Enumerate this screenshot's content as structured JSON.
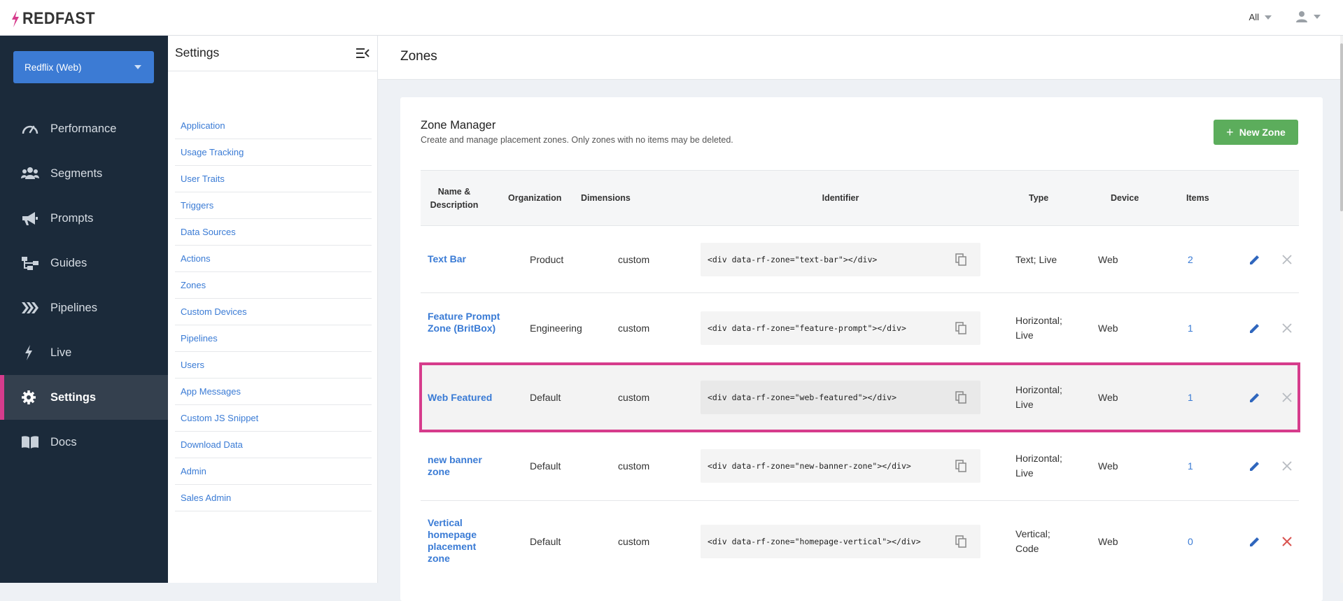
{
  "brand": {
    "name": "REDFAST"
  },
  "topbar": {
    "filter_label": "All"
  },
  "leftnav": {
    "app_selector": "Redflix (Web)",
    "items": [
      {
        "label": "Performance",
        "icon": "gauge-icon"
      },
      {
        "label": "Segments",
        "icon": "users-icon"
      },
      {
        "label": "Prompts",
        "icon": "megaphone-icon"
      },
      {
        "label": "Guides",
        "icon": "sitemap-icon"
      },
      {
        "label": "Pipelines",
        "icon": "pipelines-icon"
      },
      {
        "label": "Live",
        "icon": "bolt-icon"
      },
      {
        "label": "Settings",
        "icon": "gear-icon",
        "active": true
      },
      {
        "label": "Docs",
        "icon": "book-icon"
      }
    ]
  },
  "settings": {
    "title": "Settings",
    "items": [
      "Application",
      "Usage Tracking",
      "User Traits",
      "Triggers",
      "Data Sources",
      "Actions",
      "Zones",
      "Custom Devices",
      "Pipelines",
      "Users",
      "App Messages",
      "Custom JS Snippet",
      "Download Data",
      "Admin",
      "Sales Admin"
    ]
  },
  "page": {
    "title": "Zones"
  },
  "zone_manager": {
    "title": "Zone Manager",
    "subtitle": "Create and manage placement zones. Only zones with no items may be deleted.",
    "new_button": "New Zone",
    "columns": {
      "name": "Name & Description",
      "organization": "Organization",
      "dimensions": "Dimensions",
      "identifier": "Identifier",
      "type": "Type",
      "device": "Device",
      "items": "Items"
    },
    "rows": [
      {
        "name": "Text Bar",
        "organization": "Product",
        "dimensions": "custom",
        "identifier": "<div data-rf-zone=\"text-bar\"></div>",
        "type": "Text; Live",
        "device": "Web",
        "items": "2",
        "deletable": false
      },
      {
        "name": "Feature Prompt Zone (BritBox)",
        "organization": "Engineering",
        "dimensions": "custom",
        "identifier": "<div data-rf-zone=\"feature-prompt\"></div>",
        "type": "Horizontal; Live",
        "device": "Web",
        "items": "1",
        "deletable": false
      },
      {
        "name": "Web Featured",
        "organization": "Default",
        "dimensions": "custom",
        "identifier": "<div data-rf-zone=\"web-featured\"></div>",
        "type": "Horizontal; Live",
        "device": "Web",
        "items": "1",
        "deletable": false,
        "highlighted": true
      },
      {
        "name": "new banner zone",
        "organization": "Default",
        "dimensions": "custom",
        "identifier": "<div data-rf-zone=\"new-banner-zone\"></div>",
        "type": "Horizontal; Live",
        "device": "Web",
        "items": "1",
        "deletable": false
      },
      {
        "name": "Vertical homepage placement zone",
        "organization": "Default",
        "dimensions": "custom",
        "identifier": "<div data-rf-zone=\"homepage-vertical\"></div>",
        "type": "Vertical; Code",
        "device": "Web",
        "items": "0",
        "deletable": true
      }
    ]
  },
  "colors": {
    "accent": "#3c7bd4",
    "highlight": "#d63c8c",
    "success": "#5cad5c",
    "danger": "#d9534f",
    "nav_bg": "#1b2a3a"
  }
}
